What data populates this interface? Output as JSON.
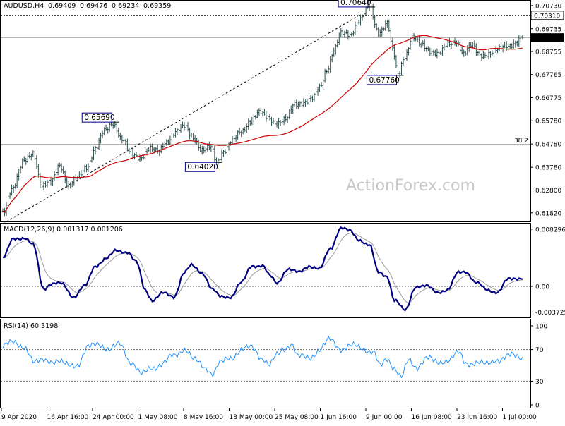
{
  "chart_data": [
    {
      "type": "ohlc",
      "title": "AUDUSD,H4",
      "header_values": [
        "0.69409",
        "0.69476",
        "0.69234",
        "0.69359"
      ],
      "watermark": "ActionForex.com",
      "ylim": [
        0.6145,
        0.7091
      ],
      "price_labels": [
        "0.70730",
        "0.70310",
        "0.69735",
        "0.69359",
        "0.68755",
        "0.67765",
        "0.66775",
        "0.65780",
        "0.64780",
        "0.63780",
        "0.62800",
        "0.61820"
      ],
      "current_price": "0.69359",
      "resistance_level": "0.70310",
      "horizontal_lines": [
        {
          "value": 0.7031,
          "style": "dashed"
        },
        {
          "value": 0.69359,
          "style": "solid"
        },
        {
          "value": 0.6476,
          "style": "solid",
          "label": "38.2"
        }
      ],
      "trendline": {
        "from": [
          0,
          0.6135
        ],
        "to": [
          200,
          0.703
        ],
        "style": "dashed"
      },
      "annotations": [
        {
          "label": "0.70640",
          "bar": 206,
          "price": 0.7064,
          "side": "left"
        },
        {
          "label": "0.67760",
          "bar": 222,
          "price": 0.6776,
          "side": "left"
        },
        {
          "label": "0.65690",
          "bar": 62,
          "price": 0.6569,
          "side": "left"
        },
        {
          "label": "0.64020",
          "bar": 120,
          "price": 0.6402,
          "side": "left"
        }
      ],
      "anchors": [
        [
          0,
          0.618
        ],
        [
          5,
          0.629
        ],
        [
          12,
          0.64
        ],
        [
          17,
          0.644
        ],
        [
          22,
          0.63
        ],
        [
          27,
          0.631
        ],
        [
          32,
          0.639
        ],
        [
          37,
          0.63
        ],
        [
          42,
          0.633
        ],
        [
          47,
          0.638
        ],
        [
          52,
          0.646
        ],
        [
          57,
          0.653
        ],
        [
          62,
          0.6569
        ],
        [
          67,
          0.65
        ],
        [
          72,
          0.643
        ],
        [
          77,
          0.642
        ],
        [
          82,
          0.646
        ],
        [
          87,
          0.644
        ],
        [
          92,
          0.649
        ],
        [
          97,
          0.653
        ],
        [
          102,
          0.655
        ],
        [
          107,
          0.651
        ],
        [
          112,
          0.645
        ],
        [
          117,
          0.646
        ],
        [
          120,
          0.6402
        ],
        [
          124,
          0.645
        ],
        [
          129,
          0.649
        ],
        [
          134,
          0.653
        ],
        [
          139,
          0.658
        ],
        [
          144,
          0.661
        ],
        [
          149,
          0.659
        ],
        [
          154,
          0.657
        ],
        [
          159,
          0.658
        ],
        [
          164,
          0.665
        ],
        [
          169,
          0.666
        ],
        [
          174,
          0.667
        ],
        [
          178,
          0.672
        ],
        [
          182,
          0.68
        ],
        [
          186,
          0.688
        ],
        [
          190,
          0.695
        ],
        [
          195,
          0.695
        ],
        [
          200,
          0.701
        ],
        [
          206,
          0.7064
        ],
        [
          211,
          0.696
        ],
        [
          216,
          0.7
        ],
        [
          219,
          0.688
        ],
        [
          222,
          0.6776
        ],
        [
          226,
          0.686
        ],
        [
          230,
          0.694
        ],
        [
          235,
          0.69
        ],
        [
          240,
          0.688
        ],
        [
          245,
          0.687
        ],
        [
          250,
          0.69
        ],
        [
          255,
          0.692
        ],
        [
          259,
          0.687
        ],
        [
          263,
          0.69
        ],
        [
          268,
          0.686
        ],
        [
          273,
          0.687
        ],
        [
          278,
          0.688
        ],
        [
          283,
          0.69
        ],
        [
          288,
          0.6915
        ],
        [
          292,
          0.6936
        ]
      ],
      "moving_average": {
        "period": 50,
        "color": "#cc0000"
      }
    },
    {
      "type": "line",
      "title": "MACD(12,26,9) 0.001317 0.001206",
      "ylim": [
        -0.0045,
        0.009
      ],
      "axis_labels": [
        "0.008296",
        "0.00",
        "-0.003725"
      ],
      "series": [
        {
          "role": "macd",
          "color": "#000080",
          "anchors": [
            [
              0,
              0.004
            ],
            [
              6,
              0.007
            ],
            [
              12,
              0.007
            ],
            [
              17,
              0.006
            ],
            [
              23,
              -0.0003
            ],
            [
              27,
              0.0003
            ],
            [
              33,
              0.0004
            ],
            [
              40,
              -0.0015
            ],
            [
              46,
              0.0
            ],
            [
              52,
              0.003
            ],
            [
              58,
              0.004
            ],
            [
              64,
              0.0052
            ],
            [
              70,
              0.005
            ],
            [
              75,
              0.0035
            ],
            [
              80,
              -0.0005
            ],
            [
              84,
              -0.002
            ],
            [
              90,
              -0.001
            ],
            [
              96,
              -0.0015
            ],
            [
              102,
              0.002
            ],
            [
              106,
              0.003
            ],
            [
              112,
              0.002
            ],
            [
              118,
              -0.0005
            ],
            [
              122,
              -0.0015
            ],
            [
              128,
              -0.0015
            ],
            [
              134,
              0.0005
            ],
            [
              140,
              0.003
            ],
            [
              146,
              0.003
            ],
            [
              150,
              0.0015
            ],
            [
              154,
              0.0005
            ],
            [
              160,
              0.0025
            ],
            [
              166,
              0.002
            ],
            [
              172,
              0.003
            ],
            [
              178,
              0.0025
            ],
            [
              184,
              0.0055
            ],
            [
              190,
              0.0085
            ],
            [
              195,
              0.008
            ],
            [
              200,
              0.0068
            ],
            [
              206,
              0.006
            ],
            [
              211,
              0.002
            ],
            [
              216,
              0.0015
            ],
            [
              220,
              -0.002
            ],
            [
              226,
              -0.0035
            ],
            [
              232,
              0.0
            ],
            [
              238,
              0.0
            ],
            [
              244,
              -0.0008
            ],
            [
              250,
              -0.0005
            ],
            [
              256,
              0.002
            ],
            [
              260,
              0.0022
            ],
            [
              266,
              0.0005
            ],
            [
              272,
              -0.0005
            ],
            [
              278,
              -0.0008
            ],
            [
              284,
              0.001
            ],
            [
              290,
              0.0012
            ],
            [
              292,
              0.0013
            ]
          ]
        },
        {
          "role": "signal",
          "color": "#999999",
          "smoothing": 9
        }
      ]
    },
    {
      "type": "line",
      "title": "RSI(14) 60.3198",
      "ylim": [
        0,
        100
      ],
      "axis_labels": [
        "100",
        "70",
        "30",
        "0"
      ],
      "levels": [
        70,
        30
      ],
      "series": [
        {
          "role": "rsi",
          "color": "#1e90ff",
          "anchors": [
            [
              0,
              75
            ],
            [
              6,
              78
            ],
            [
              12,
              75
            ],
            [
              18,
              52
            ],
            [
              24,
              58
            ],
            [
              30,
              55
            ],
            [
              36,
              50
            ],
            [
              42,
              52
            ],
            [
              48,
              72
            ],
            [
              54,
              78
            ],
            [
              60,
              70
            ],
            [
              66,
              76
            ],
            [
              72,
              55
            ],
            [
              78,
              38
            ],
            [
              84,
              48
            ],
            [
              90,
              52
            ],
            [
              96,
              62
            ],
            [
              102,
              72
            ],
            [
              108,
              55
            ],
            [
              114,
              48
            ],
            [
              118,
              40
            ],
            [
              122,
              52
            ],
            [
              128,
              60
            ],
            [
              134,
              70
            ],
            [
              140,
              72
            ],
            [
              146,
              60
            ],
            [
              150,
              50
            ],
            [
              154,
              62
            ],
            [
              158,
              72
            ],
            [
              162,
              78
            ],
            [
              166,
              60
            ],
            [
              172,
              60
            ],
            [
              178,
              70
            ],
            [
              184,
              82
            ],
            [
              190,
              72
            ],
            [
              196,
              74
            ],
            [
              202,
              72
            ],
            [
              208,
              68
            ],
            [
              212,
              48
            ],
            [
              216,
              58
            ],
            [
              220,
              48
            ],
            [
              224,
              35
            ],
            [
              228,
              55
            ],
            [
              232,
              48
            ],
            [
              238,
              60
            ],
            [
              244,
              52
            ],
            [
              250,
              58
            ],
            [
              256,
              65
            ],
            [
              260,
              52
            ],
            [
              266,
              55
            ],
            [
              272,
              50
            ],
            [
              278,
              58
            ],
            [
              284,
              62
            ],
            [
              290,
              60
            ],
            [
              292,
              60
            ]
          ]
        }
      ]
    }
  ],
  "x_axis": {
    "labels": [
      "9 Apr 2020",
      "16 Apr 16:00",
      "24 Apr 00:00",
      "1 May 08:00",
      "8 May 16:00",
      "18 May 00:00",
      "25 May 08:00",
      "1 Jun 16:00",
      "9 Jun 00:00",
      "16 Jun 08:00",
      "23 Jun 16:00",
      "1 Jul 00:00"
    ]
  }
}
